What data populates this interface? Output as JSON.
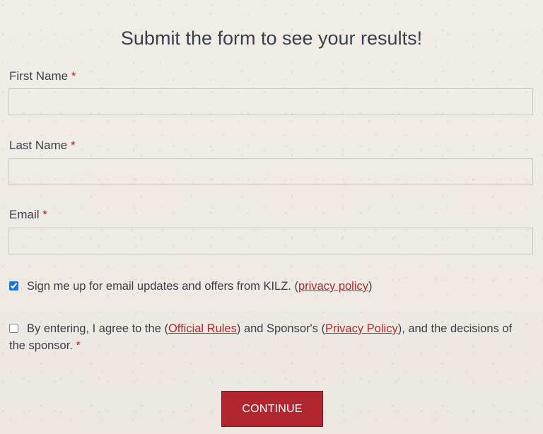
{
  "form": {
    "title": "Submit the form to see your results!",
    "required_marker": "*",
    "first_name": {
      "label": "First Name",
      "value": "",
      "placeholder": ""
    },
    "last_name": {
      "label": "Last Name",
      "value": "",
      "placeholder": ""
    },
    "email": {
      "label": "Email",
      "value": "",
      "placeholder": ""
    },
    "newsletter": {
      "checked": true,
      "text_before": "Sign me up for email updates and offers from KILZ. (",
      "link_label": "privacy policy",
      "text_after": ")"
    },
    "rules": {
      "checked": false,
      "text_1": "By entering, I agree to the (",
      "official_rules_label": "Official Rules",
      "text_2": ") and Sponsor's (",
      "privacy_policy_label": "Privacy Policy",
      "text_3": "), and the decisions of the sponsor. "
    },
    "continue_label": "CONTINUE"
  },
  "colors": {
    "background": "#efebe5",
    "text": "#383f4a",
    "accent": "#b1262f",
    "checkbox": "#1a73e8"
  }
}
